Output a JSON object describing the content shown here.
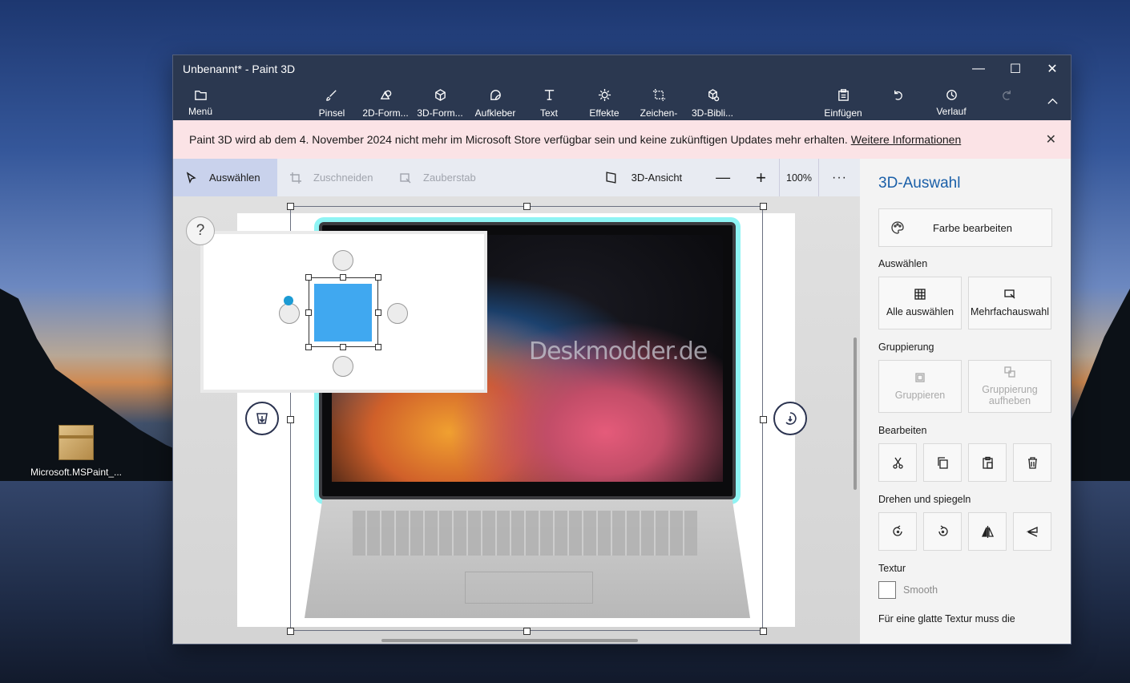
{
  "desktop": {
    "icon_label": "Microsoft.MSPaint_..."
  },
  "window": {
    "title": "Unbenannt* - Paint 3D",
    "controls": {
      "minimize": "—",
      "maximize": "☐",
      "close": "✕"
    }
  },
  "toolbar": {
    "menu": "Menü",
    "tools": [
      {
        "label": "Pinsel",
        "icon": "brush-icon"
      },
      {
        "label": "2D-Form...",
        "icon": "2d-shapes-icon"
      },
      {
        "label": "3D-Form...",
        "icon": "3d-shapes-icon"
      },
      {
        "label": "Aufkleber",
        "icon": "sticker-icon"
      },
      {
        "label": "Text",
        "icon": "text-icon"
      },
      {
        "label": "Effekte",
        "icon": "effects-icon"
      },
      {
        "label": "Zeichen-",
        "icon": "canvas-icon"
      },
      {
        "label": "3D-Bibli...",
        "icon": "3d-library-icon"
      }
    ],
    "paste": "Einfügen",
    "history": "Verlauf"
  },
  "banner": {
    "message": "Paint 3D wird ab dem 4. November 2024 nicht mehr im Microsoft Store verfügbar sein und keine zukünftigen Updates mehr erhalten.",
    "link": "Weitere Informationen"
  },
  "subbar": {
    "select": "Auswählen",
    "crop": "Zuschneiden",
    "magic_select": "Zauberstab",
    "view_3d": "3D-Ansicht",
    "zoom": "100%",
    "more": "···"
  },
  "canvas": {
    "help": "?",
    "watermark": "Deskmodder.de"
  },
  "panel": {
    "title": "3D-Auswahl",
    "edit_color": "Farbe bearbeiten",
    "select_heading": "Auswählen",
    "select_all": "Alle auswählen",
    "multi_select": "Mehrfachauswahl",
    "group_heading": "Gruppierung",
    "group": "Gruppieren",
    "ungroup": "Gruppierung aufheben",
    "edit_heading": "Bearbeiten",
    "rotate_heading": "Drehen und spiegeln",
    "texture_heading": "Textur",
    "smooth": "Smooth",
    "note": "Für eine glatte Textur muss die"
  },
  "colors": {
    "titlebar": "#2b3850",
    "accent": "#1a5fa8",
    "selection_glow": "#8ff4f4",
    "banner": "#fbe3e6"
  }
}
